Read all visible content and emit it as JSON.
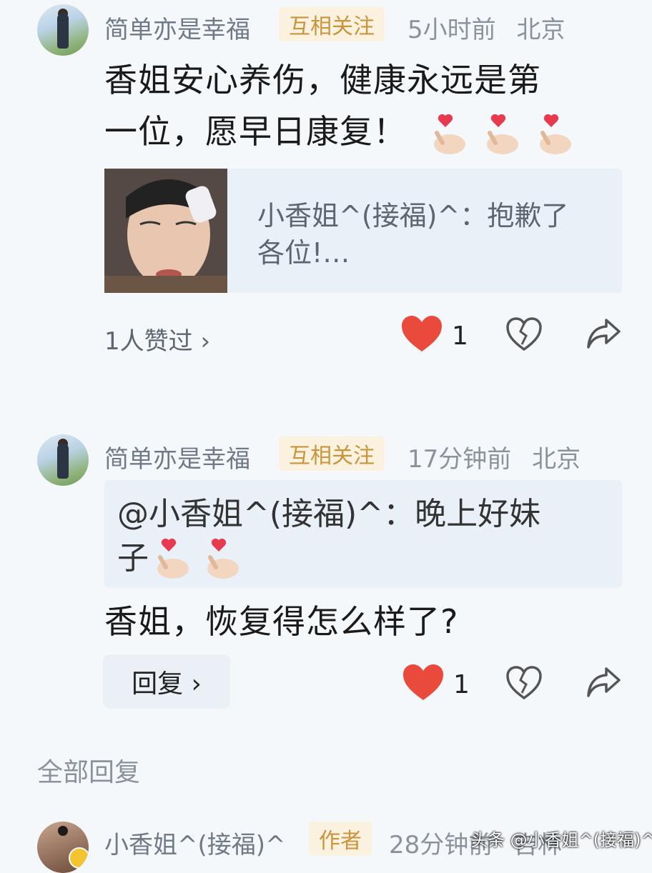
{
  "comment1": {
    "username": "简单亦是幸福",
    "badge": "互相关注",
    "time": "5小时前",
    "location": "北京",
    "text_line1": "香姐安心养伤，健康永远是第",
    "text_line2": "一位，愿早日康复！",
    "emoji_count": 3,
    "quote": {
      "line1": "小香姐^(接福)^：抱歉了",
      "line2": "各位!…"
    },
    "liked_by": "1人赞过 ›",
    "like_count": "1"
  },
  "comment2": {
    "username": "简单亦是幸福",
    "badge": "互相关注",
    "time": "17分钟前",
    "location": "北京",
    "quote_line1": "@小香姐^(接福)^：晚上好妹",
    "quote_line2": "子",
    "text": "香姐，恢复得怎么样了?",
    "reply_label": "回复 ›",
    "like_count": "1"
  },
  "section_title": "全部回复",
  "comment3": {
    "username": "小香姐^(接福)^",
    "badge": "作者",
    "time": "28分钟前",
    "location": "吉林"
  },
  "watermark": "头条 @小香姐^(接福)^",
  "colors": {
    "heart_liked": "#ea4a3c",
    "background": "#f5f8fb",
    "badge_text": "#c8953c"
  }
}
